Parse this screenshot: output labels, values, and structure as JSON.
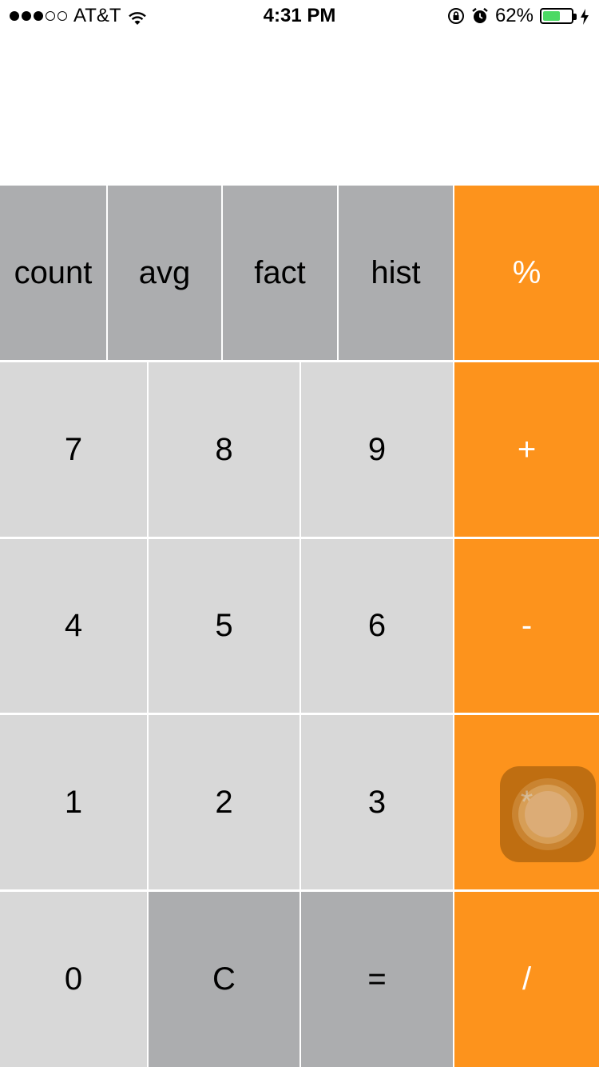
{
  "status_bar": {
    "signal_filled": 3,
    "signal_total": 5,
    "carrier": "AT&T",
    "time": "4:31 PM",
    "battery_percent_label": "62%",
    "battery_level": 0.62,
    "icons": [
      "wifi-icon",
      "rotation-lock-icon",
      "alarm-icon",
      "battery-icon",
      "charging-bolt-icon"
    ]
  },
  "display": {
    "value": ""
  },
  "colors": {
    "function_key": "#acadaf",
    "number_key": "#d8d8d8",
    "operator_key": "#fd931c",
    "battery_fill": "#4cd964"
  },
  "keypad": {
    "function_row": [
      "count",
      "avg",
      "fact",
      "hist"
    ],
    "percent": "%",
    "row1": [
      "7",
      "8",
      "9"
    ],
    "plus": "+",
    "row2": [
      "4",
      "5",
      "6"
    ],
    "minus": "-",
    "row3": [
      "1",
      "2",
      "3"
    ],
    "multiply": "*",
    "zero": "0",
    "clear": "C",
    "equals": "=",
    "divide": "/"
  }
}
